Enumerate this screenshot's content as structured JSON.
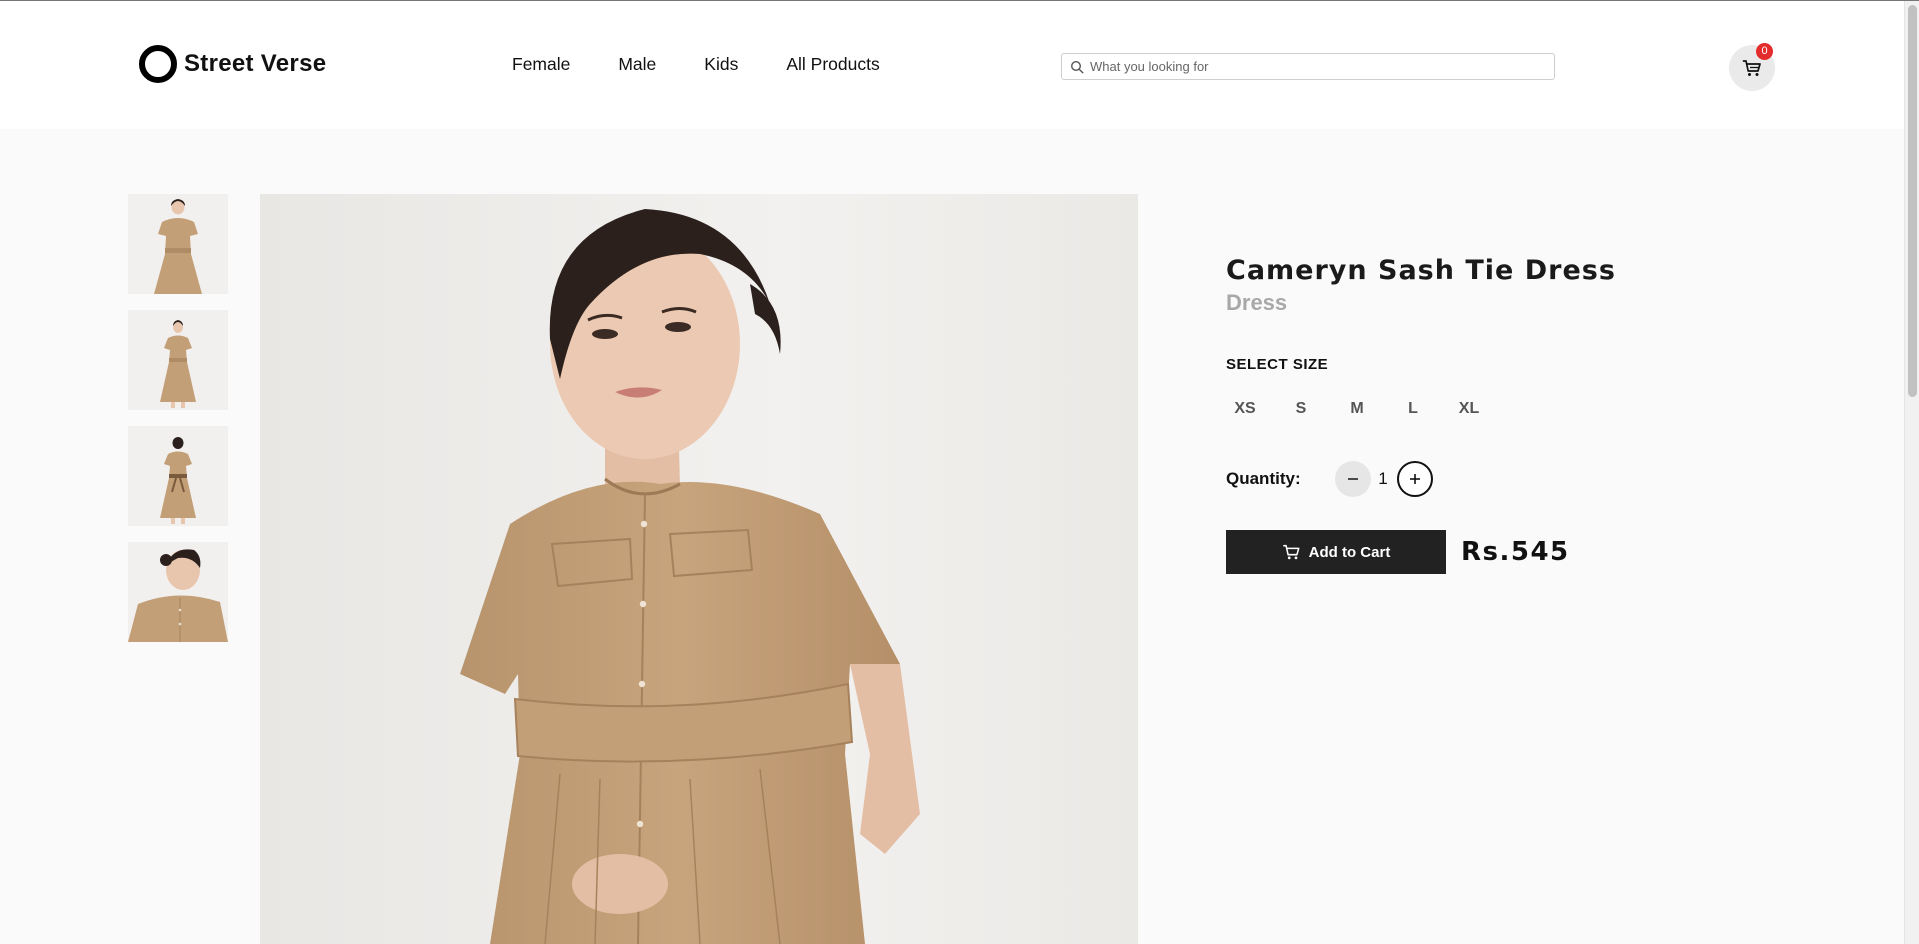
{
  "brand": {
    "name": "Street Verse"
  },
  "nav": {
    "items": [
      {
        "label": "Female"
      },
      {
        "label": "Male"
      },
      {
        "label": "Kids"
      },
      {
        "label": "All Products"
      }
    ]
  },
  "search": {
    "placeholder": "What you looking for",
    "icon": "search-icon"
  },
  "cart": {
    "count": "0",
    "icon": "cart-icon",
    "badge_color": "#e42c2c"
  },
  "gallery": {
    "thumbnails": [
      "front view",
      "full length view",
      "back view",
      "close-up view"
    ]
  },
  "product": {
    "name": "Cameryn Sash Tie Dress",
    "category": "Dress",
    "size_label": "SELECT SIZE",
    "sizes": [
      "XS",
      "S",
      "M",
      "L",
      "XL"
    ],
    "quantity_label": "Quantity:",
    "quantity": "1",
    "add_to_cart": "Add to Cart",
    "price": "Rs.545"
  },
  "colors": {
    "accent": "#222222",
    "dress": "#c39f78",
    "muted_text": "#a8a8a8"
  }
}
